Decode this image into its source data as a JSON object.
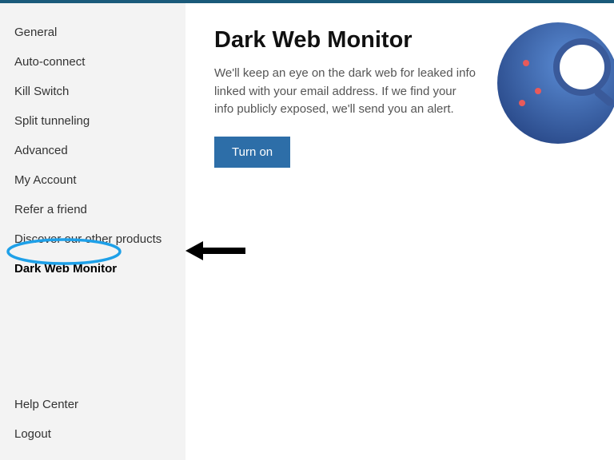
{
  "sidebar": {
    "items": [
      {
        "label": "General"
      },
      {
        "label": "Auto-connect"
      },
      {
        "label": "Kill Switch"
      },
      {
        "label": "Split tunneling"
      },
      {
        "label": "Advanced"
      },
      {
        "label": "My Account"
      },
      {
        "label": "Refer a friend"
      },
      {
        "label": "Discover our other products"
      },
      {
        "label": "Dark Web Monitor"
      }
    ],
    "bottom": [
      {
        "label": "Help Center"
      },
      {
        "label": "Logout"
      }
    ]
  },
  "main": {
    "title": "Dark Web Monitor",
    "description": "We'll keep an eye on the dark web for leaked info linked with your email address. If we find your info publicly exposed, we'll send you an alert.",
    "button_label": "Turn on"
  },
  "colors": {
    "accent": "#2d6ea8",
    "highlight": "#1ea0e8"
  }
}
